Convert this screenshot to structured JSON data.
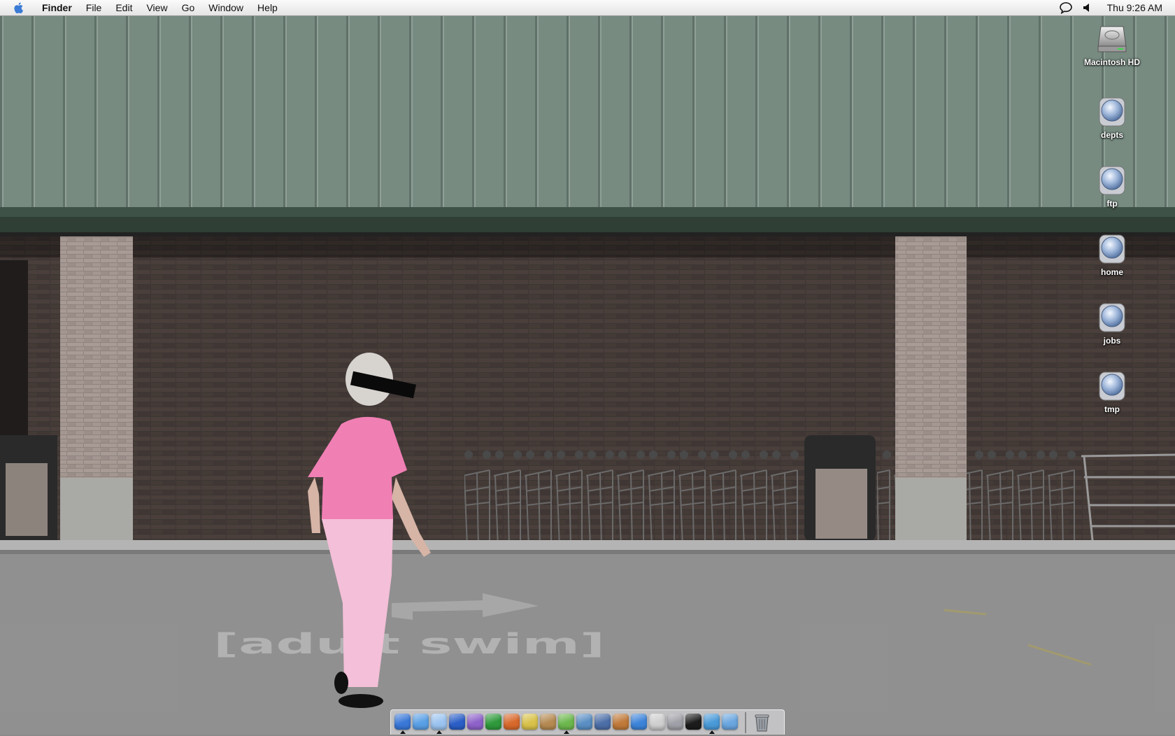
{
  "menubar": {
    "app_name": "Finder",
    "items": [
      "File",
      "Edit",
      "View",
      "Go",
      "Window",
      "Help"
    ],
    "clock": "Thu 9:26 AM",
    "status_icons": [
      "ichat-status-icon",
      "volume-icon"
    ]
  },
  "desktop": {
    "icons": [
      {
        "label": "Macintosh HD",
        "icon": "hard-drive-icon"
      },
      {
        "label": "depts",
        "icon": "network-volume-icon"
      },
      {
        "label": "ftp",
        "icon": "network-volume-icon"
      },
      {
        "label": "home",
        "icon": "network-volume-icon"
      },
      {
        "label": "jobs",
        "icon": "network-volume-icon"
      },
      {
        "label": "tmp",
        "icon": "network-volume-icon"
      }
    ]
  },
  "wallpaper": {
    "pavement_text": "[adult swim]"
  },
  "dock": {
    "items": [
      {
        "name": "finder",
        "color": "#3a78d8",
        "running": true
      },
      {
        "name": "safari",
        "color": "#5aa0e6",
        "running": false
      },
      {
        "name": "ichat",
        "color": "#9cc4f0",
        "running": true
      },
      {
        "name": "word",
        "color": "#2b5fc7",
        "running": false
      },
      {
        "name": "entourage",
        "color": "#8e62c9",
        "running": false
      },
      {
        "name": "excel",
        "color": "#2f9a3c",
        "running": false
      },
      {
        "name": "powerpoint",
        "color": "#d8692c",
        "running": false
      },
      {
        "name": "preview",
        "color": "#d9c24a",
        "running": false
      },
      {
        "name": "address-book",
        "color": "#b58a52",
        "running": false
      },
      {
        "name": "itunes",
        "color": "#6db84e",
        "running": true
      },
      {
        "name": "iphoto",
        "color": "#5b8fc4",
        "running": false
      },
      {
        "name": "imovie",
        "color": "#4d6fa8",
        "running": false
      },
      {
        "name": "garageband",
        "color": "#c07a3a",
        "running": false
      },
      {
        "name": "quicktime",
        "color": "#3d84d9",
        "running": false
      },
      {
        "name": "printer",
        "color": "#cfcfcf",
        "running": false
      },
      {
        "name": "system-prefs",
        "color": "#a0a0a8",
        "running": false
      },
      {
        "name": "terminal",
        "color": "#1c1c1c",
        "running": false
      },
      {
        "name": "network-utility",
        "color": "#4a9ad8",
        "running": true
      },
      {
        "name": "mail",
        "color": "#6aa6df",
        "running": false
      }
    ],
    "trash": {
      "name": "trash",
      "color": "#9aa0a8"
    }
  }
}
